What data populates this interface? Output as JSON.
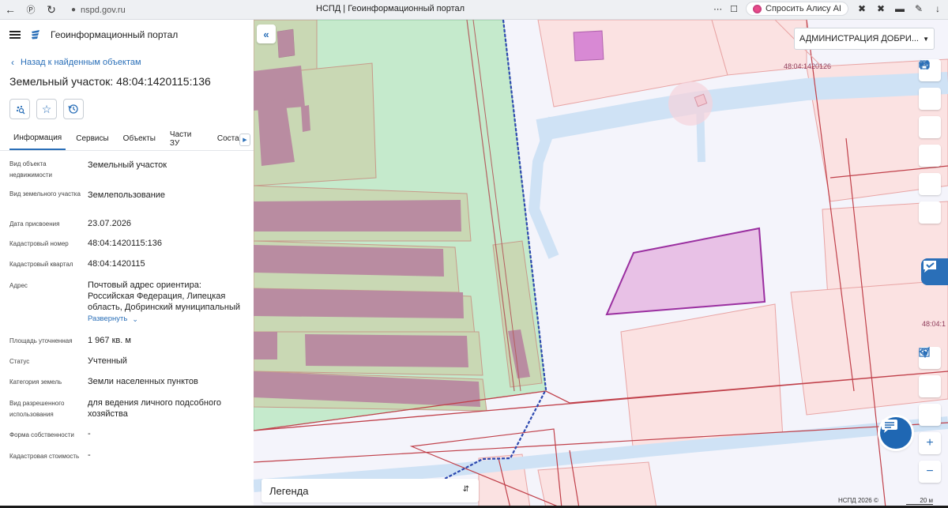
{
  "browser": {
    "url": "nspd.gov.ru",
    "tab_title": "НСПД | Геоинформационный портал",
    "alice_label": "Спросить Алису AI"
  },
  "app": {
    "title": "Геоинформационный портал",
    "back_label": "Назад к найденным объектам",
    "object_title": "Земельный участок: 48:04:1420115:136"
  },
  "tabs": [
    "Информация",
    "Сервисы",
    "Объекты",
    "Части ЗУ",
    "Состав"
  ],
  "properties": [
    {
      "label": "Вид объекта недвижимости",
      "value": "Земельный участок"
    },
    {
      "label": "Вид земельного участка",
      "value": "Землепользование"
    },
    {
      "label": "Дата присвоения",
      "value": "23.07.2026"
    },
    {
      "label": "Кадастровый номер",
      "value": "48:04:1420115:136"
    },
    {
      "label": "Кадастровый квартал",
      "value": "48:04:1420115"
    },
    {
      "label": "Адрес",
      "value": "Почтовый адрес ориентира: Российская Федерация, Липецкая область, Добринский муниципальный"
    },
    {
      "label": "Площадь уточненная",
      "value": "1 967 кв. м"
    },
    {
      "label": "Статус",
      "value": "Учтенный"
    },
    {
      "label": "Категория земель",
      "value": "Земли населенных пунктов"
    },
    {
      "label": "Вид разрешенного использования",
      "value": "для ведения личного подсобного хозяйства"
    },
    {
      "label": "Форма собственности",
      "value": "-"
    },
    {
      "label": "Кадастровая стоимость",
      "value": "-"
    }
  ],
  "expand_label": "Развернуть",
  "map": {
    "admin_select": "АДМИНИСТРАЦИЯ ДОБРИ...",
    "label_top": "48:04:1420126",
    "label_right": "48:04:1",
    "legend_label": "Легенда",
    "credit": "НСПД 2026 ©",
    "scale_label": "20 м"
  },
  "colors": {
    "accent": "#2a6fb8",
    "parcel_fill": "#e8c1e6",
    "parcel_stroke": "#9a2fa0",
    "green_zone": "#c5eacc"
  }
}
